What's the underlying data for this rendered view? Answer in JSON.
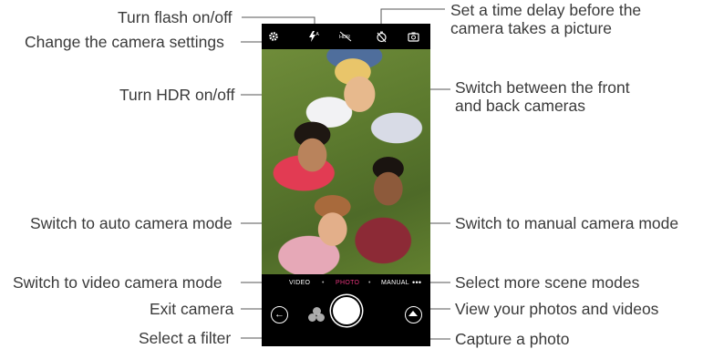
{
  "camera": {
    "modes": [
      "VIDEO",
      "PHOTO",
      "MANUAL"
    ],
    "active_mode": "PHOTO",
    "more_modes_glyph": "•••",
    "accent_color": "#e2347a",
    "icons": {
      "settings": "gear-icon",
      "flash": "flash-auto-icon",
      "hdr": "hdr-off-icon",
      "timer": "timer-off-icon",
      "switch_camera": "switch-camera-icon",
      "exit": "back-arrow-icon",
      "filter": "filter-icon",
      "shutter": "shutter-button",
      "gallery": "gallery-icon"
    }
  },
  "callouts": {
    "flash": "Turn flash on/off",
    "settings": "Change the camera settings",
    "hdr": "Turn HDR on/off",
    "auto_mode": "Switch to auto camera mode",
    "video_mode": "Switch to video camera mode",
    "exit": "Exit camera",
    "filter": "Select a filter",
    "timer": "Set a time delay before the camera takes a picture",
    "switch_camera": "Switch between the front and back cameras",
    "manual_mode": "Switch to manual camera mode",
    "more_modes": "Select more scene modes",
    "gallery": "View your photos and videos",
    "capture": "Capture a photo"
  }
}
